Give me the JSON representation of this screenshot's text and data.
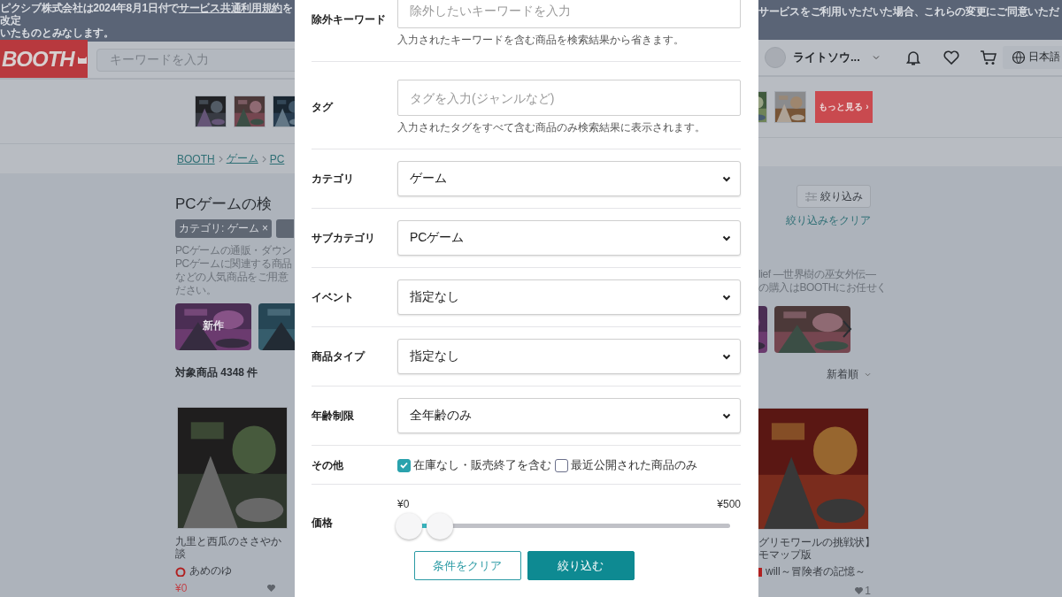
{
  "notice": {
    "left": {
      "before": "ピクシブ株式会社は2024年8月1日付で",
      "link": "サービス共通利用規約",
      "after": "を改定",
      "line_2": "いたものとみなします。"
    },
    "right": "サービスをご利用いただいた場合、これらの変更にご同意いただ"
  },
  "header": {
    "logo": "BOOTH",
    "search_placeholder": "キーワードを入力",
    "user_name": "ライトソウ...",
    "language": "日本語"
  },
  "featured": {
    "more_button": "もっと見る ›"
  },
  "breadcrumb": [
    "BOOTH",
    "ゲーム",
    "PC"
  ],
  "page": {
    "title": "PCゲームの検",
    "filter_chip": "カテゴリ: ゲーム ×",
    "description_left": [
      "PCゲームの通販・ダウン",
      "PCゲームに関連する商品",
      "などの人気商品をご用意",
      "ださい。"
    ],
    "description_right": [
      "lief —世界樹の巫女外伝—",
      "の購入はBOOTHにお任せく"
    ],
    "filter_button": "絞り込み",
    "clear_filters_link": "絞り込みをクリア",
    "banner_label": "新作",
    "result_count": "対象商品 4348 件",
    "sort": "新着順"
  },
  "products": [
    {
      "title_lines": [
        "九里と西瓜のささやか",
        "談"
      ],
      "shop": "あめのゆ",
      "price": "¥0"
    },
    {
      "title_lines": [
        "グリモワールの挑戦状】",
        "モマップ版"
      ],
      "shop": "will～冒険者の記憶～",
      "likes": "1"
    }
  ],
  "filter_dialog": {
    "rows": [
      {
        "kind": "text",
        "label": "除外キーワード",
        "placeholder": "除外したいキーワードを入力",
        "help": "入力されたキーワードを含む商品を検索結果から省きます。"
      },
      {
        "kind": "text",
        "label": "タグ",
        "placeholder": "タグを入力(ジャンルなど)",
        "help": "入力されたタグをすべて含む商品のみ検索結果に表示されます。"
      },
      {
        "kind": "select",
        "label": "カテゴリ",
        "value": "ゲーム"
      },
      {
        "kind": "select",
        "label": "サブカテゴリ",
        "value": "PCゲーム"
      },
      {
        "kind": "select",
        "label": "イベント",
        "value": "指定なし"
      },
      {
        "kind": "select",
        "label": "商品タイプ",
        "value": "指定なし"
      },
      {
        "kind": "select",
        "label": "年齢制限",
        "value": "全年齢のみ"
      },
      {
        "kind": "checks",
        "label": "その他",
        "options": [
          {
            "label": "在庫なし・販売終了を含む",
            "checked": true
          },
          {
            "label": "最近公開された商品のみ",
            "checked": false
          }
        ]
      },
      {
        "kind": "range",
        "label": "価格",
        "min_label": "¥0",
        "max_label": "¥500",
        "thumbs": [
          {
            "level": 0
          },
          {
            "level": 0.1
          }
        ]
      }
    ],
    "buttons": [
      {
        "kind": "secondary",
        "label": "条件をクリア"
      },
      {
        "kind": "primary",
        "label": "絞り込む"
      }
    ]
  }
}
